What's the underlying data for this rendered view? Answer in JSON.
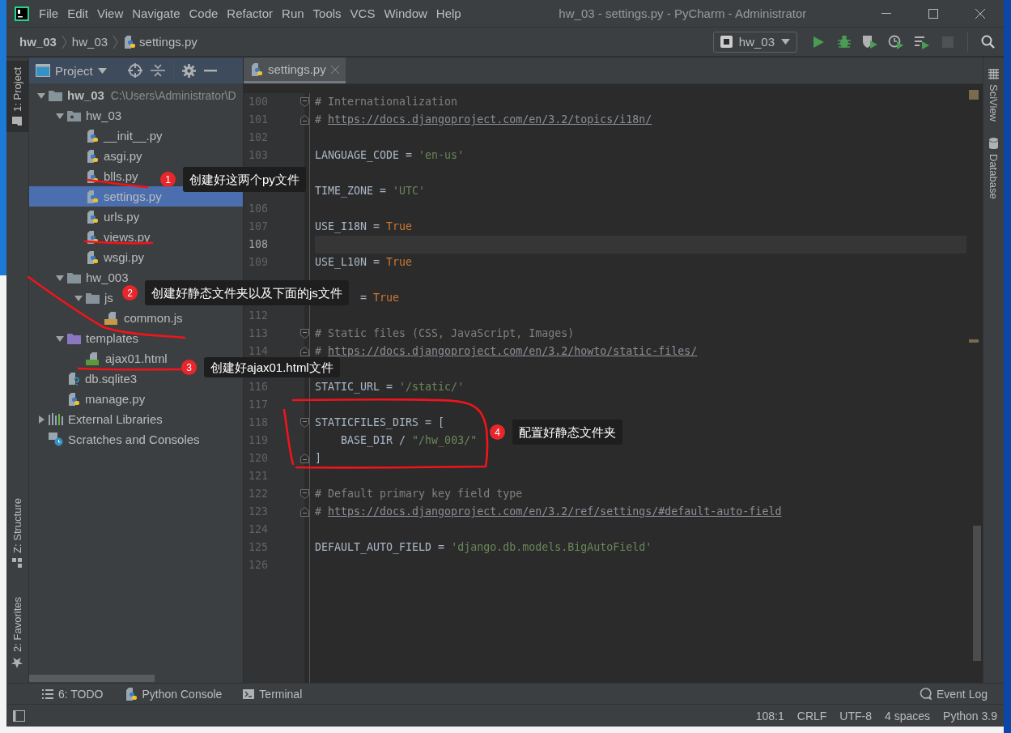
{
  "window": {
    "title": "hw_03 - settings.py - PyCharm - Administrator"
  },
  "menu": [
    "File",
    "Edit",
    "View",
    "Navigate",
    "Code",
    "Refactor",
    "Run",
    "Tools",
    "VCS",
    "Window",
    "Help"
  ],
  "breadcrumbs": [
    {
      "text": "hw_03",
      "kind": "project"
    },
    {
      "text": "hw_03",
      "kind": "folder"
    },
    {
      "text": "settings.py",
      "kind": "python"
    }
  ],
  "run_config": {
    "label": "hw_03"
  },
  "actions": [
    {
      "kind": "run",
      "disabled": false
    },
    {
      "kind": "debug",
      "disabled": false
    },
    {
      "kind": "coverage",
      "disabled": false
    },
    {
      "kind": "profile",
      "disabled": false
    },
    {
      "kind": "concurrency",
      "disabled": false
    },
    {
      "kind": "stop",
      "disabled": true
    }
  ],
  "left_tool_tabs": [
    {
      "label": "1: Project",
      "kind": "project",
      "selected": true
    },
    {
      "label": "Z: Structure",
      "kind": "structure",
      "selected": false
    },
    {
      "label": "2: Favorites",
      "kind": "favorites",
      "selected": false
    }
  ],
  "right_tool_tabs": [
    {
      "label": "SciView",
      "kind": "sciview"
    },
    {
      "label": "Database",
      "kind": "database"
    }
  ],
  "project": {
    "title": "Project",
    "tree": [
      {
        "label": "hw_03",
        "path": "C:\\Users\\Administrator\\D",
        "kind": "project-root",
        "expanded": true,
        "selected": false,
        "children": [
          {
            "label": "hw_03",
            "kind": "package",
            "expanded": true,
            "selected": false,
            "children": [
              {
                "label": "__init__.py",
                "kind": "python",
                "selected": false
              },
              {
                "label": "asgi.py",
                "kind": "python",
                "selected": false
              },
              {
                "label": "blls.py",
                "kind": "python",
                "selected": false
              },
              {
                "label": "settings.py",
                "kind": "python",
                "selected": true
              },
              {
                "label": "urls.py",
                "kind": "python",
                "selected": false
              },
              {
                "label": "views.py",
                "kind": "python",
                "selected": false
              },
              {
                "label": "wsgi.py",
                "kind": "python",
                "selected": false
              }
            ]
          },
          {
            "label": "hw_003",
            "kind": "folder",
            "expanded": true,
            "selected": false,
            "children": [
              {
                "label": "js",
                "kind": "folder",
                "expanded": true,
                "selected": false,
                "children": [
                  {
                    "label": "common.js",
                    "kind": "js",
                    "selected": false
                  }
                ]
              }
            ]
          },
          {
            "label": "templates",
            "kind": "template-folder",
            "expanded": true,
            "selected": false,
            "children": [
              {
                "label": "ajax01.html",
                "kind": "html",
                "selected": false
              }
            ]
          },
          {
            "label": "db.sqlite3",
            "kind": "unknown",
            "selected": false
          },
          {
            "label": "manage.py",
            "kind": "python",
            "selected": false
          }
        ]
      },
      {
        "label": "External Libraries",
        "kind": "library",
        "expanded": false,
        "selected": false
      },
      {
        "label": "Scratches and Consoles",
        "kind": "scratches",
        "selected": false
      }
    ]
  },
  "editor": {
    "tabs": [
      {
        "label": "settings.py",
        "selected": true
      }
    ],
    "lines": [
      {
        "kind": "code",
        "num": "100",
        "fold_start": true,
        "segments": [
          {
            "kind": "comment",
            "text": "# Internationalization"
          }
        ]
      },
      {
        "kind": "code",
        "num": "101",
        "fold_end": true,
        "segments": [
          {
            "kind": "comment",
            "text": "# "
          },
          {
            "kind": "link",
            "text": "https://docs.djangoproject.com/en/3.2/topics/i18n/"
          }
        ]
      },
      {
        "kind": "code",
        "num": "102"
      },
      {
        "kind": "code",
        "num": "103",
        "segments": [
          {
            "kind": "ident",
            "text": "LANGUAGE_CODE = "
          },
          {
            "kind": "string",
            "text": "'en-us'"
          }
        ]
      },
      {
        "kind": "covered"
      },
      {
        "kind": "covered",
        "segments": [
          {
            "kind": "ident",
            "text": "TIME_ZONE = "
          },
          {
            "kind": "string",
            "text": "'UTC'"
          }
        ]
      },
      {
        "kind": "code",
        "num": "106"
      },
      {
        "kind": "code",
        "num": "107",
        "segments": [
          {
            "kind": "ident",
            "text": "USE_I18N = "
          },
          {
            "kind": "keyword",
            "text": "True"
          }
        ]
      },
      {
        "kind": "code",
        "num": "108",
        "current": true
      },
      {
        "kind": "code",
        "num": "109",
        "segments": [
          {
            "kind": "ident",
            "text": "USE_L10N = "
          },
          {
            "kind": "keyword",
            "text": "True"
          }
        ]
      },
      {
        "kind": "covered"
      },
      {
        "kind": "covered",
        "covered_start": true,
        "segments": [
          {
            "kind": "ident",
            "text": "= "
          },
          {
            "kind": "keyword",
            "text": "True"
          }
        ]
      },
      {
        "kind": "code",
        "num": "112"
      },
      {
        "kind": "code",
        "num": "113",
        "fold_start": true,
        "segments": [
          {
            "kind": "comment",
            "text": "# Static files (CSS, JavaScript, Images)"
          }
        ]
      },
      {
        "kind": "code",
        "num": "114",
        "fold_end": true,
        "segments": [
          {
            "kind": "comment",
            "text": "# "
          },
          {
            "kind": "link",
            "text": "https://docs.djangoproject.com/en/3.2/howto/static-files/"
          }
        ]
      },
      {
        "kind": "covered"
      },
      {
        "kind": "code",
        "num": "116",
        "segments": [
          {
            "kind": "ident",
            "text": "STATIC_URL = "
          },
          {
            "kind": "string",
            "text": "'/static/'"
          }
        ]
      },
      {
        "kind": "code",
        "num": "117"
      },
      {
        "kind": "code",
        "num": "118",
        "fold_start": true,
        "segments": [
          {
            "kind": "ident",
            "text": "STATICFILES_DIRS = ["
          }
        ]
      },
      {
        "kind": "code",
        "num": "119",
        "segments": [
          {
            "kind": "ident",
            "text": "    BASE_DIR / "
          },
          {
            "kind": "string",
            "text": "\"/hw_003/\""
          }
        ]
      },
      {
        "kind": "code",
        "num": "120",
        "fold_end": true,
        "segments": [
          {
            "kind": "ident",
            "text": "]"
          }
        ]
      },
      {
        "kind": "code",
        "num": "121"
      },
      {
        "kind": "code",
        "num": "122",
        "fold_start": true,
        "segments": [
          {
            "kind": "comment",
            "text": "# Default primary key field type"
          }
        ]
      },
      {
        "kind": "code",
        "num": "123",
        "fold_end": true,
        "segments": [
          {
            "kind": "comment",
            "text": "# "
          },
          {
            "kind": "link",
            "text": "https://docs.djangoproject.com/en/3.2/ref/settings/#default-auto-field"
          }
        ]
      },
      {
        "kind": "code",
        "num": "124"
      },
      {
        "kind": "code",
        "num": "125",
        "segments": [
          {
            "kind": "ident",
            "text": "DEFAULT_AUTO_FIELD = "
          },
          {
            "kind": "string",
            "text": "'django.db.models.BigAutoField'"
          }
        ]
      },
      {
        "kind": "code",
        "num": "126"
      }
    ]
  },
  "bottom_tools": [
    {
      "label": "6: TODO",
      "kind": "todo"
    },
    {
      "label": "Python Console",
      "kind": "console"
    },
    {
      "label": "Terminal",
      "kind": "terminal"
    }
  ],
  "event_log": {
    "label": "Event Log"
  },
  "status_bar": [
    "108:1",
    "CRLF",
    "UTF-8",
    "4 spaces",
    "Python 3.9"
  ],
  "annotations": [
    {
      "number": "1",
      "text": "创建好这两个py文件"
    },
    {
      "number": "2",
      "text": "创建好静态文件夹以及下面的js文件"
    },
    {
      "number": "3",
      "text": "创建好ajax01.html文件"
    },
    {
      "number": "4",
      "text": "配置好静态文件夹"
    }
  ]
}
